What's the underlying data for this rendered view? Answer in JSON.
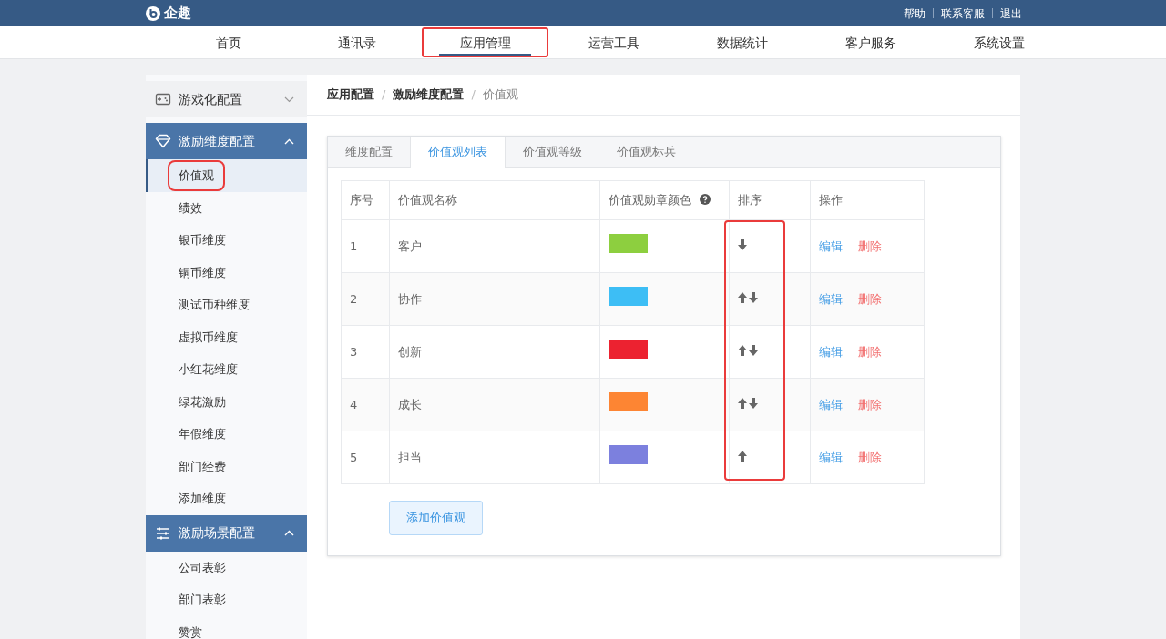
{
  "header": {
    "brand": "企趣",
    "links": [
      "帮助",
      "联系客服",
      "退出"
    ]
  },
  "nav": [
    {
      "label": "首页",
      "selected": false,
      "highlighted": false
    },
    {
      "label": "通讯录",
      "selected": false,
      "highlighted": false
    },
    {
      "label": "应用管理",
      "selected": true,
      "highlighted": true
    },
    {
      "label": "运营工具",
      "selected": false,
      "highlighted": false
    },
    {
      "label": "数据统计",
      "selected": false,
      "highlighted": false
    },
    {
      "label": "客户服务",
      "selected": false,
      "highlighted": false
    },
    {
      "label": "系统设置",
      "selected": false,
      "highlighted": false
    }
  ],
  "sidebar": {
    "groups": [
      {
        "label": "游戏化配置",
        "expanded": false
      },
      {
        "label": "激励维度配置",
        "expanded": true,
        "items": [
          {
            "label": "价值观",
            "selected": true,
            "highlighted": true
          },
          {
            "label": "绩效",
            "selected": false,
            "highlighted": false
          },
          {
            "label": "银币维度",
            "selected": false,
            "highlighted": false
          },
          {
            "label": "铜币维度",
            "selected": false,
            "highlighted": false
          },
          {
            "label": "测试币种维度",
            "selected": false,
            "highlighted": false
          },
          {
            "label": "虚拟币维度",
            "selected": false,
            "highlighted": false
          },
          {
            "label": "小红花维度",
            "selected": false,
            "highlighted": false
          },
          {
            "label": "绿花激励",
            "selected": false,
            "highlighted": false
          },
          {
            "label": "年假维度",
            "selected": false,
            "highlighted": false
          },
          {
            "label": "部门经费",
            "selected": false,
            "highlighted": false
          },
          {
            "label": "添加维度",
            "selected": false,
            "highlighted": false
          }
        ]
      },
      {
        "label": "激励场景配置",
        "expanded": true,
        "items": [
          {
            "label": "公司表彰",
            "selected": false,
            "highlighted": false
          },
          {
            "label": "部门表彰",
            "selected": false,
            "highlighted": false
          },
          {
            "label": "赞赏",
            "selected": false,
            "highlighted": false
          }
        ]
      }
    ]
  },
  "breadcrumb": {
    "items": [
      "应用配置",
      "激励维度配置",
      "价值观"
    ],
    "separator": "/"
  },
  "tabs": [
    {
      "label": "维度配置",
      "selected": false
    },
    {
      "label": "价值观列表",
      "selected": true
    },
    {
      "label": "价值观等级",
      "selected": false
    },
    {
      "label": "价值观标兵",
      "selected": false
    }
  ],
  "table": {
    "columns": [
      {
        "label": "序号",
        "help": false
      },
      {
        "label": "价值观名称",
        "help": false
      },
      {
        "label": "价值观勋章颜色",
        "help": true
      },
      {
        "label": "排序",
        "help": false
      },
      {
        "label": "操作",
        "help": false
      }
    ],
    "sort_column_highlighted": true,
    "rows": [
      {
        "index": "1",
        "name": "客户",
        "color": "#8dcf3f",
        "can_move_up": false,
        "can_move_down": true,
        "actions": [
          "编辑",
          "删除"
        ]
      },
      {
        "index": "2",
        "name": "协作",
        "color": "#3dbef5",
        "can_move_up": true,
        "can_move_down": true,
        "actions": [
          "编辑",
          "删除"
        ]
      },
      {
        "index": "3",
        "name": "创新",
        "color": "#ec2230",
        "can_move_up": true,
        "can_move_down": true,
        "actions": [
          "编辑",
          "删除"
        ]
      },
      {
        "index": "4",
        "name": "成长",
        "color": "#fd8533",
        "can_move_up": true,
        "can_move_down": true,
        "actions": [
          "编辑",
          "删除"
        ]
      },
      {
        "index": "5",
        "name": "担当",
        "color": "#7c80de",
        "can_move_up": true,
        "can_move_down": false,
        "actions": [
          "编辑",
          "删除"
        ]
      }
    ]
  },
  "add_button": "添加价值观"
}
